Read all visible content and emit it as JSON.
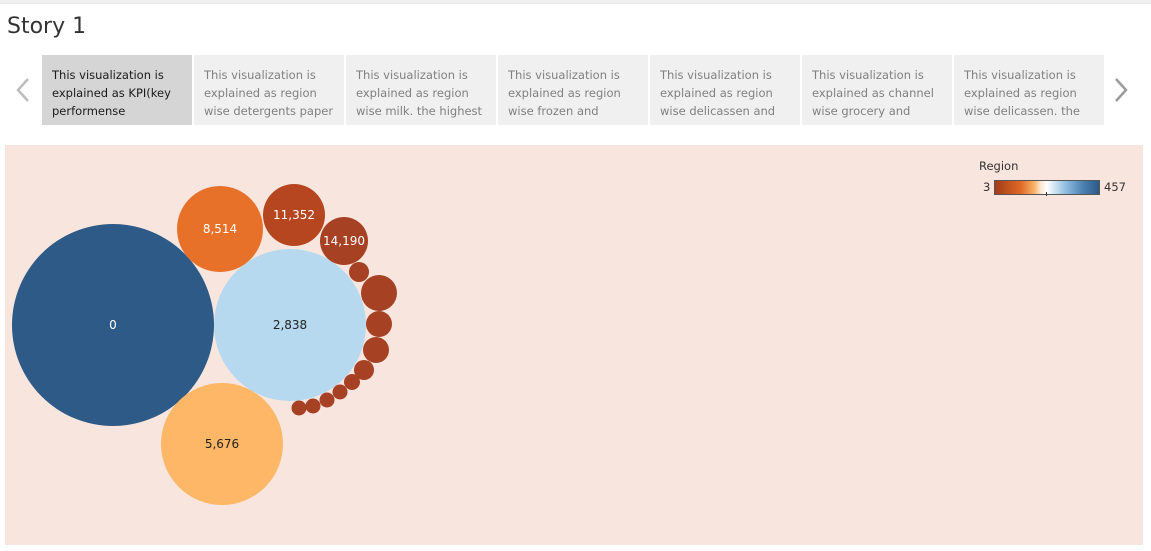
{
  "story": {
    "title": "Story 1"
  },
  "nav": {
    "prev_icon": "chevron-left-icon",
    "next_icon": "chevron-right-icon"
  },
  "captions": [
    {
      "text": "This visualization is\nexplained as KPI(key\nperformense",
      "active": true
    },
    {
      "text": "This visualization is\nexplained as region\nwise detergents paper",
      "active": false
    },
    {
      "text": "This visualization is\nexplained as region\nwise milk. the highest",
      "active": false
    },
    {
      "text": "This visualization is\nexplained as region\nwise frozen and",
      "active": false
    },
    {
      "text": "This visualization is\nexplained as region\nwise delicassen and",
      "active": false
    },
    {
      "text": "This visualization is\nexplained as channel\nwise grocery and",
      "active": false
    },
    {
      "text": "This visualization is\nexplained as region\nwise delicassen. the",
      "active": false
    }
  ],
  "legend": {
    "title": "Region",
    "min": "3",
    "max": "457"
  },
  "colors": {
    "background": "#f8e5de",
    "dark_blue": "#2d5a87",
    "light_blue": "#b6d9ef",
    "orange": "#e8712a",
    "light_orange": "#fdb766",
    "dark_orange": "#b5461f",
    "rust": "#a64124"
  },
  "bubbles": [
    {
      "label": "0",
      "color": "#2d5a87",
      "text_color": "#ffffff"
    },
    {
      "label": "2,838",
      "color": "#b6d9ef",
      "text_color": "#222222"
    },
    {
      "label": "5,676",
      "color": "#fdb766",
      "text_color": "#222222"
    },
    {
      "label": "8,514",
      "color": "#e8712a",
      "text_color": "#ffffff"
    },
    {
      "label": "11,352",
      "color": "#b5461f",
      "text_color": "#ffffff"
    },
    {
      "label": "14,190",
      "color": "#a64124",
      "text_color": "#ffffff"
    },
    {
      "label": "",
      "color": "#a64124",
      "text_color": "#ffffff"
    },
    {
      "label": "",
      "color": "#a64124",
      "text_color": "#ffffff"
    },
    {
      "label": "",
      "color": "#a64124",
      "text_color": "#ffffff"
    },
    {
      "label": "",
      "color": "#a64124",
      "text_color": "#ffffff"
    },
    {
      "label": "",
      "color": "#a64124",
      "text_color": "#ffffff"
    },
    {
      "label": "",
      "color": "#a64124",
      "text_color": "#ffffff"
    },
    {
      "label": "",
      "color": "#a64124",
      "text_color": "#ffffff"
    },
    {
      "label": "",
      "color": "#a64124",
      "text_color": "#ffffff"
    },
    {
      "label": "",
      "color": "#a64124",
      "text_color": "#ffffff"
    },
    {
      "label": "",
      "color": "#a64124",
      "text_color": "#ffffff"
    }
  ]
}
